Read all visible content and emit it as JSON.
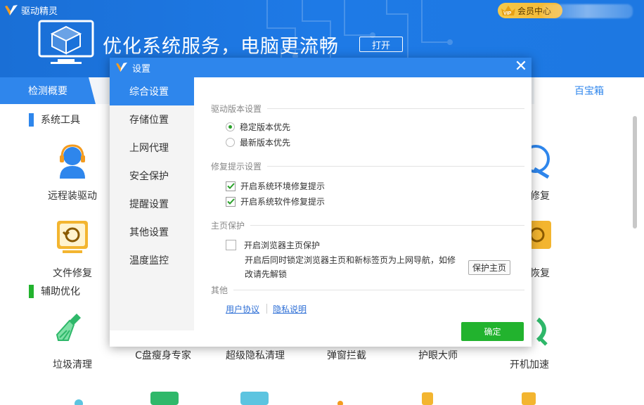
{
  "app": {
    "title": "驱动精灵",
    "vip_label": "会员中心"
  },
  "banner": {
    "text": "优化系统服务，电脑更流畅",
    "open_button": "打开"
  },
  "nav": {
    "active_tab": "检测概要",
    "right_tab": "百宝箱"
  },
  "sections": {
    "system_tools": "系统工具",
    "aux_optimize": "辅助优化"
  },
  "tools_row1": [
    "远程装驱动",
    "修复"
  ],
  "tools_row2": [
    "文件修复",
    "恢复"
  ],
  "tools_row3": [
    "垃圾清理",
    "C盘瘦身专家",
    "超级隐私清理",
    "弹窗拦截",
    "护眼大师",
    "开机加速"
  ],
  "dialog": {
    "title": "设置",
    "close_glyph": "✕",
    "sidebar": [
      "综合设置",
      "存储位置",
      "上网代理",
      "安全保护",
      "提醒设置",
      "其他设置",
      "温度监控"
    ],
    "active_index": 0,
    "driver_version": {
      "title": "驱动版本设置",
      "options": [
        "稳定版本优先",
        "最新版本优先"
      ],
      "selected": 0
    },
    "repair_prompt": {
      "title": "修复提示设置",
      "options": [
        "开启系统环境修复提示",
        "开启系统软件修复提示"
      ],
      "checked": [
        true,
        true
      ]
    },
    "homepage": {
      "title": "主页保护",
      "option": "开启浏览器主页保护",
      "checked": false,
      "description": "开启后同时锁定浏览器主页和新标签页为上网导航，如修改请先解锁",
      "protect_button": "保护主页"
    },
    "other": {
      "title": "其他",
      "user_agreement": "用户协议",
      "privacy": "隐私说明"
    },
    "ok_button": "确定"
  },
  "colors": {
    "header_blue": "#1e7ae6",
    "dialog_blue": "#2e86ec",
    "ok_green": "#22b32e",
    "radio_green": "#2aa12a",
    "vip_gold": "#f3b530"
  }
}
